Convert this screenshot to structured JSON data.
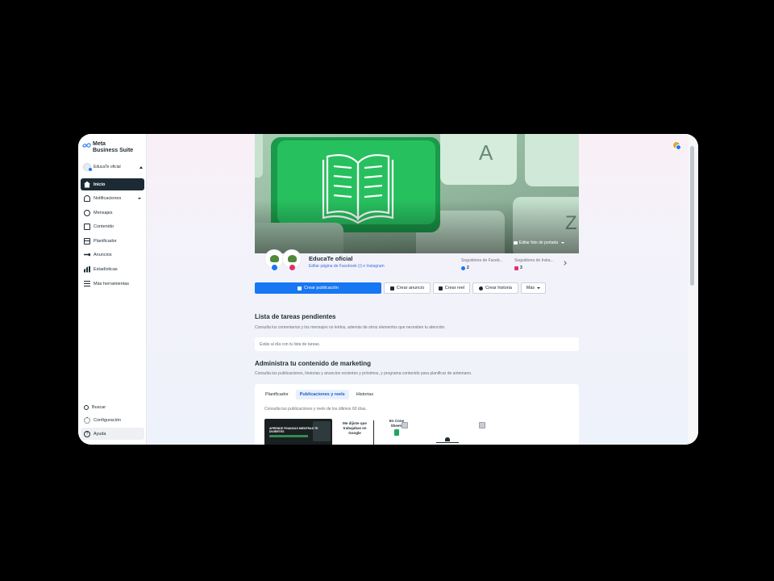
{
  "brand": {
    "line1": "Meta",
    "line2": "Business Suite"
  },
  "account": {
    "name": "EducaTe oficial"
  },
  "sidebar": {
    "items": [
      {
        "label": "Inicio",
        "icon": "home-icon",
        "active": true
      },
      {
        "label": "Notificaciones",
        "icon": "bell-icon",
        "has_dropdown": true
      },
      {
        "label": "Mensajes",
        "icon": "chat-icon"
      },
      {
        "label": "Contenido",
        "icon": "content-icon"
      },
      {
        "label": "Planificador",
        "icon": "calendar-icon"
      },
      {
        "label": "Anuncios",
        "icon": "megaphone-icon"
      },
      {
        "label": "Estadísticas",
        "icon": "bar-chart-icon"
      },
      {
        "label": "Más herramientas",
        "icon": "menu-icon"
      }
    ],
    "bottom": [
      {
        "label": "Buscar",
        "icon": "search-icon"
      },
      {
        "label": "Configuración",
        "icon": "gear-icon"
      },
      {
        "label": "Ayuda",
        "icon": "help-icon"
      }
    ]
  },
  "cover": {
    "edit_label": "Editar foto de portada"
  },
  "page": {
    "name": "EducaTe oficial",
    "edit_link": "Editar página de Facebook (/) e Instagram",
    "stats": [
      {
        "label": "Seguidores de Faceb...",
        "value": "2",
        "network": "facebook"
      },
      {
        "label": "Seguidores de Insta...",
        "value": "3",
        "network": "instagram"
      }
    ]
  },
  "actions": {
    "create_post": "Crear publicación",
    "create_ad": "Crear anuncio",
    "create_reel": "Crear reel",
    "create_story": "Crear historia",
    "more": "Más"
  },
  "todo": {
    "title": "Lista de tareas pendientes",
    "subtitle": "Consulta los comentarios y los mensajes no leídos, además de otros elementos que necesiten tu atención.",
    "status": "Estás al día con tu lista de tareas."
  },
  "marketing": {
    "title": "Administra tu contenido de marketing",
    "subtitle": "Consulta tus publicaciones, historias y anuncios recientes y próximos, y programa contenido para planificar de antemano.",
    "tabs": [
      {
        "label": "Planificador",
        "active": false
      },
      {
        "label": "Publicaciones y reels",
        "active": true
      },
      {
        "label": "Historias",
        "active": false
      }
    ],
    "tab_subtitle": "Consulta tus publicaciones y reels de los últimos 60 días.",
    "thumbs": {
      "t1": "APRENDE FINANZAS MIENTRAS TE DIVIERTES",
      "t2": "Me dijiste que trabajabas en Google",
      "t3_line": "En Cone Sheets"
    }
  },
  "colors": {
    "accent": "#1877f2",
    "nav_active": "#1c2b33",
    "key_green": "#1fb35a"
  }
}
